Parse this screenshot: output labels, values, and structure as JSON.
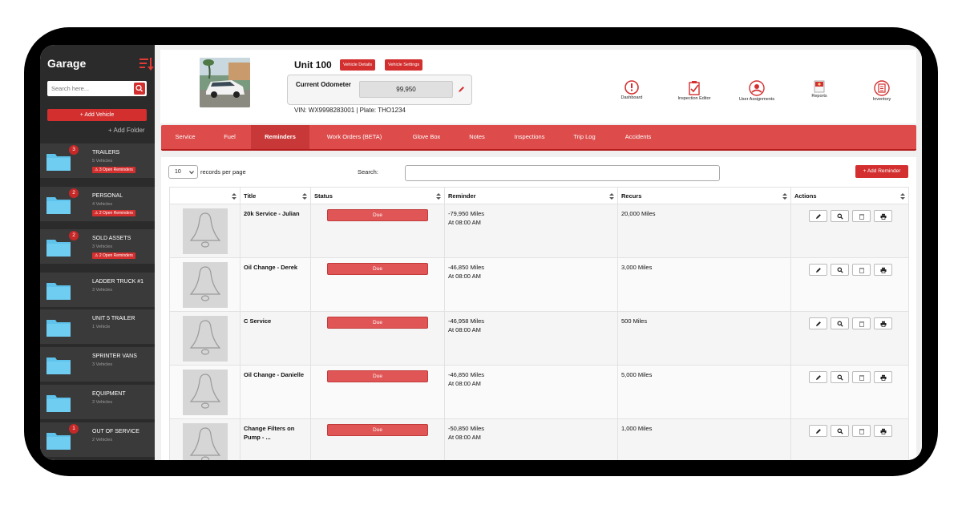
{
  "sidebar": {
    "title": "Garage",
    "search_placeholder": "Search here...",
    "add_vehicle_label": "+ Add Vehicle",
    "add_folder_label": "+ Add Folder",
    "folders": [
      {
        "name": "TRAILERS",
        "sub": "5 Vehicles",
        "badge": "3",
        "chip": "⚠ 3 Open Reminders"
      },
      {
        "name": "PERSONAL",
        "sub": "4 Vehicles",
        "badge": "2",
        "chip": "⚠ 2 Open Reminders"
      },
      {
        "name": "SOLD ASSETS",
        "sub": "3 Vehicles",
        "badge": "2",
        "chip": "⚠ 2 Open Reminders"
      },
      {
        "name": "LADDER TRUCK #1",
        "sub": "3 Vehicles",
        "badge": "",
        "chip": ""
      },
      {
        "name": "UNIT 5 TRAILER",
        "sub": "1 Vehicle",
        "badge": "",
        "chip": ""
      },
      {
        "name": "SPRINTER VANS",
        "sub": "3 Vehicles",
        "badge": "",
        "chip": ""
      },
      {
        "name": "EQUIPMENT",
        "sub": "3 Vehicles",
        "badge": "",
        "chip": ""
      },
      {
        "name": "OUT OF SERVICE",
        "sub": "2 Vehicles",
        "badge": "1",
        "chip": ""
      }
    ]
  },
  "header": {
    "unit_title": "Unit 100",
    "vehicle_details_label": "Vehicle Details",
    "vehicle_settings_label": "Vehicle Settings",
    "odometer_label": "Current Odometer",
    "odometer_value": "99,950",
    "vin_plate": "VIN: WX9998283001 | Plate: THO1234",
    "nav": [
      "Dashboard",
      "Inspection Editor",
      "User Assignments",
      "Reports",
      "Inventory"
    ]
  },
  "tabs": [
    "Service",
    "Fuel",
    "Reminders",
    "Work Orders (BETA)",
    "Glove Box",
    "Notes",
    "Inspections",
    "Trip Log",
    "Accidents"
  ],
  "active_tab": "Reminders",
  "toolbar": {
    "records_value": "10",
    "records_label": "records per page",
    "search_label": "Search:",
    "add_reminder_label": "+ Add Reminder"
  },
  "table": {
    "columns": [
      "",
      "Title",
      "Status",
      "Reminder",
      "Recurs",
      "Actions"
    ],
    "rows": [
      {
        "title": "20k Service - Julian",
        "status": "Due",
        "reminder_1": "-79,950 Miles",
        "reminder_2": "At 08:00 AM",
        "recurs": "20,000 Miles"
      },
      {
        "title": "Oil Change - Derek",
        "status": "Due",
        "reminder_1": "-46,850 Miles",
        "reminder_2": "At 08:00 AM",
        "recurs": "3,000 Miles"
      },
      {
        "title": "C Service",
        "status": "Due",
        "reminder_1": "-46,958 Miles",
        "reminder_2": "At 08:00 AM",
        "recurs": "500 Miles"
      },
      {
        "title": "Oil Change - Danielle",
        "status": "Due",
        "reminder_1": "-46,850 Miles",
        "reminder_2": "At 08:00 AM",
        "recurs": "5,000 Miles"
      },
      {
        "title": "Change Filters on Pump - ...",
        "status": "Due",
        "reminder_1": "-50,850 Miles",
        "reminder_2": "At 08:00 AM",
        "recurs": "1,000 Miles"
      }
    ]
  },
  "colors": {
    "accent": "#d32f2f",
    "tab_bar": "#dd4b4b",
    "sidebar": "#2b2b2b",
    "folder": "#5ec2ea"
  }
}
